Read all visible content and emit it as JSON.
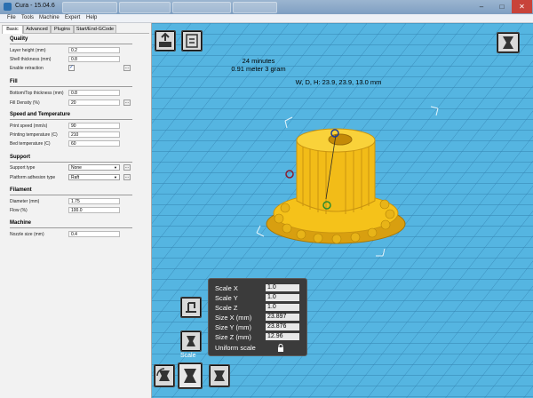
{
  "window": {
    "title": "Cura - 15.04.6"
  },
  "menubar": {
    "items": [
      "File",
      "Tools",
      "Machine",
      "Expert",
      "Help"
    ]
  },
  "sidebar": {
    "tabs": [
      "Basic",
      "Advanced",
      "Plugins",
      "Start/End-GCode"
    ],
    "sections": {
      "quality": {
        "title": "Quality",
        "layer_height": {
          "label": "Layer height (mm)",
          "value": "0.2"
        },
        "shell_thickness": {
          "label": "Shell thickness (mm)",
          "value": "0.8"
        },
        "enable_retraction": {
          "label": "Enable retraction",
          "checked": "✓",
          "button": "..."
        }
      },
      "fill": {
        "title": "Fill",
        "bottom_top": {
          "label": "Bottom/Top thickness (mm)",
          "value": "0.8"
        },
        "fill_density": {
          "label": "Fill Density (%)",
          "value": "20",
          "button": "..."
        }
      },
      "speed": {
        "title": "Speed and Temperature",
        "print_speed": {
          "label": "Print speed (mm/s)",
          "value": "90"
        },
        "print_temp": {
          "label": "Printing temperature (C)",
          "value": "210"
        },
        "bed_temp": {
          "label": "Bed temperature (C)",
          "value": "60"
        }
      },
      "support": {
        "title": "Support",
        "support_type": {
          "label": "Support type",
          "value": "None",
          "button": "..."
        },
        "adhesion": {
          "label": "Platform adhesion type",
          "value": "Raft",
          "button": "..."
        }
      },
      "filament": {
        "title": "Filament",
        "diameter": {
          "label": "Diameter (mm)",
          "value": "1.75"
        },
        "flow": {
          "label": "Flow (%)",
          "value": "100.0"
        }
      },
      "machine": {
        "title": "Machine",
        "nozzle": {
          "label": "Nozzle size (mm)",
          "value": "0.4"
        }
      }
    }
  },
  "viewport": {
    "print_time": "24 minutes",
    "material": "0.91 meter 3 gram",
    "dimensions": "W, D, H: 23.9, 23.9, 13.0 mm",
    "model_color": "#f5c21a",
    "grid_color": "#4eb0df"
  },
  "scale_panel": {
    "rows": [
      {
        "label": "Scale X",
        "value": "1.0"
      },
      {
        "label": "Scale Y",
        "value": "1.0"
      },
      {
        "label": "Scale Z",
        "value": "1.0"
      },
      {
        "label": "Size X (mm)",
        "value": "23.897"
      },
      {
        "label": "Size Y (mm)",
        "value": "23.876"
      },
      {
        "label": "Size Z (mm)",
        "value": "12.96"
      }
    ],
    "uniform_label": "Uniform scale",
    "caption": "Scale"
  }
}
